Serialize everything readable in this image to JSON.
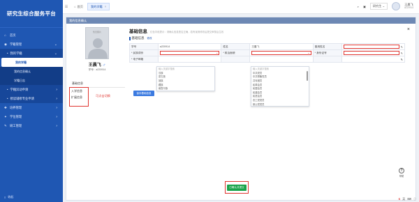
{
  "brand": "研究生综合服务平台",
  "sidebar": {
    "items": [
      {
        "label": "首页",
        "level": 0,
        "arrow": ""
      },
      {
        "label": "学籍管理",
        "level": 0,
        "arrow": "⌄"
      },
      {
        "label": "我的学籍",
        "level": 1,
        "arrow": "⌄"
      },
      {
        "label": "我的学籍",
        "level": 2,
        "arrow": "",
        "active": true
      },
      {
        "label": "我的信息确认",
        "level": 2,
        "arrow": ""
      },
      {
        "label": "学籍日志",
        "level": 2,
        "arrow": ""
      },
      {
        "label": "学籍异动申请",
        "level": 1,
        "arrow": "›"
      },
      {
        "label": "修读辅修专业申请",
        "level": 1,
        "arrow": "›"
      },
      {
        "label": "培养管理",
        "level": 0,
        "arrow": "›"
      },
      {
        "label": "学位管理",
        "level": 0,
        "arrow": "›"
      },
      {
        "label": "研工管理",
        "level": 0,
        "arrow": "›"
      }
    ],
    "footer": "收起"
  },
  "topbar": {
    "tabs": [
      {
        "label": "首页"
      },
      {
        "label": "我的学籍",
        "close": "×"
      }
    ],
    "select_value": "研究生",
    "user_name": "王晨飞",
    "user_id": "a220914"
  },
  "page_head": "我的信息确认",
  "profile": {
    "photo_label": "暂无照片",
    "name": "王晨飞",
    "gender_icon": "♂",
    "id": "学号：a220914"
  },
  "side_tabs": {
    "title": "基础信息",
    "tabs": [
      "入学信息",
      "扩展信息"
    ],
    "hint": "可点击切换"
  },
  "main": {
    "title": "基础信息",
    "note": "红色字段提示：请确认信息是否正确，若有误请修改后提交审核后生效",
    "subtitle": "基础信息",
    "subtitle_action": "修改",
    "close": "×",
    "rows": [
      [
        {
          "lab": "学号",
          "val": "a220914"
        },
        {
          "lab": "姓名",
          "val": "王晨飞"
        },
        {
          "lab": "曾用姓名",
          "val": "",
          "type": "input-red"
        }
      ],
      [
        {
          "lab": "* 民族成份",
          "val": "",
          "type": "select-red"
        },
        {
          "lab": "* 政治面貌",
          "val": "",
          "type": "select-red"
        },
        {
          "lab": "* 身份证号",
          "val": "",
          "type": "input-red"
        }
      ],
      [
        {
          "lab": "* 电子邮箱",
          "val": "",
          "type": "blank"
        },
        {
          "lab": "",
          "val": "",
          "type": "blank"
        },
        {
          "lab": "",
          "val": "",
          "type": "blank"
        }
      ]
    ],
    "dropdown_left": [
      "输入关键字搜索",
      "汉族",
      "蒙古族",
      "回族",
      "藏族",
      "维吾尔族"
    ],
    "dropdown_right": [
      "输入关键字搜索",
      "中共党员",
      "中共预备党员",
      "共青团员",
      "民革会员",
      "民盟会员",
      "民建会员",
      "民进会员",
      "农工党党员",
      "致公党党员"
    ],
    "save_button": "保存基础信息"
  },
  "bottom_button": "已确认并提交",
  "help": {
    "icon": "?",
    "label": "帮助"
  },
  "tray": [
    "S",
    "英",
    "⌨",
    "ⓘ"
  ]
}
